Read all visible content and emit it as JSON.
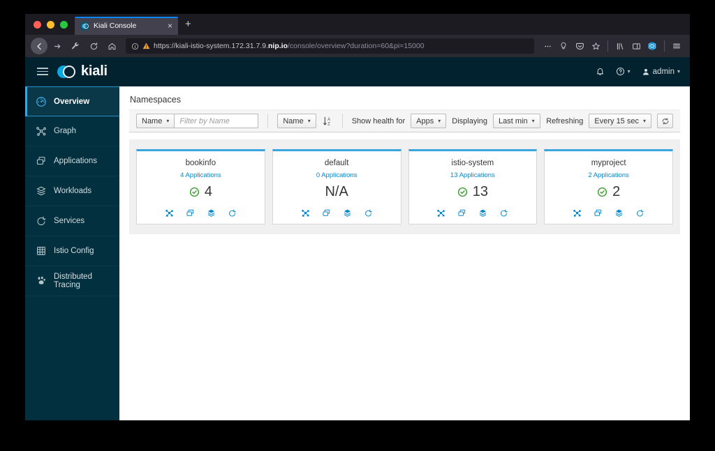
{
  "browser": {
    "tab": {
      "title": "Kiali Console",
      "favicon": "kiali-logo-icon",
      "close_label": "×"
    },
    "new_tab_label": "+",
    "url": {
      "scheme": "https://",
      "host_main": "kiali-istio-system.172.31.7.9.",
      "host_bold": "nip.io",
      "path": "/console/overview?duration=60&pi=15000"
    },
    "toolbar_icons": [
      "back-icon",
      "forward-icon",
      "devtools-wrench-icon",
      "reload-icon",
      "home-icon"
    ],
    "right_icons": [
      "ellipsis-icon",
      "lightbulb-icon",
      "pocket-icon",
      "bookmark-star-icon",
      "library-icon",
      "sidebar-icon",
      "extension-icon",
      "app-menu-icon"
    ]
  },
  "masthead": {
    "brand": "kiali",
    "menu_toggle": "hamburger-icon",
    "notifications": "bell-icon",
    "help": "help-icon",
    "user": "admin"
  },
  "sidebar": {
    "items": [
      {
        "label": "Overview",
        "icon": "dashboard-icon",
        "active": true
      },
      {
        "label": "Graph",
        "icon": "topology-icon",
        "active": false
      },
      {
        "label": "Applications",
        "icon": "applications-icon",
        "active": false
      },
      {
        "label": "Workloads",
        "icon": "workloads-icon",
        "active": false
      },
      {
        "label": "Services",
        "icon": "services-icon",
        "active": false
      },
      {
        "label": "Istio Config",
        "icon": "istio-config-icon",
        "active": false
      },
      {
        "label": "Distributed Tracing",
        "icon": "tracing-icon",
        "active": false
      }
    ]
  },
  "page": {
    "title": "Namespaces"
  },
  "toolbar": {
    "filter_type": "Name",
    "filter_placeholder": "Filter by Name",
    "filter_value": "",
    "sort_by": "Name",
    "sort_icon": "sort-alpha-down-icon",
    "health_label": "Show health for",
    "health_value": "Apps",
    "displaying_label": "Displaying",
    "displaying_value": "Last min",
    "refreshing_label": "Refreshing",
    "refreshing_value": "Every 15 sec",
    "refresh_icon": "sync-icon"
  },
  "namespaces": [
    {
      "name": "bookinfo",
      "apps_label": "4 Applications",
      "health_status": "healthy",
      "health_value": "4",
      "actions": [
        "graph-icon",
        "applications-icon",
        "workloads-icon",
        "services-icon"
      ]
    },
    {
      "name": "default",
      "apps_label": "0 Applications",
      "health_status": "na",
      "health_value": "N/A",
      "actions": [
        "graph-icon",
        "applications-icon",
        "workloads-icon",
        "services-icon"
      ]
    },
    {
      "name": "istio-system",
      "apps_label": "13 Applications",
      "health_status": "healthy",
      "health_value": "13",
      "actions": [
        "graph-icon",
        "applications-icon",
        "workloads-icon",
        "services-icon"
      ]
    },
    {
      "name": "myproject",
      "apps_label": "2 Applications",
      "health_status": "healthy",
      "health_value": "2",
      "actions": [
        "graph-icon",
        "applications-icon",
        "workloads-icon",
        "services-icon"
      ]
    }
  ],
  "colors": {
    "brand_blue": "#39a5dc",
    "link_blue": "#0088ce",
    "masthead_dark": "#03222f",
    "sidebar_dark": "#03303f",
    "health_green": "#3f9c35"
  }
}
